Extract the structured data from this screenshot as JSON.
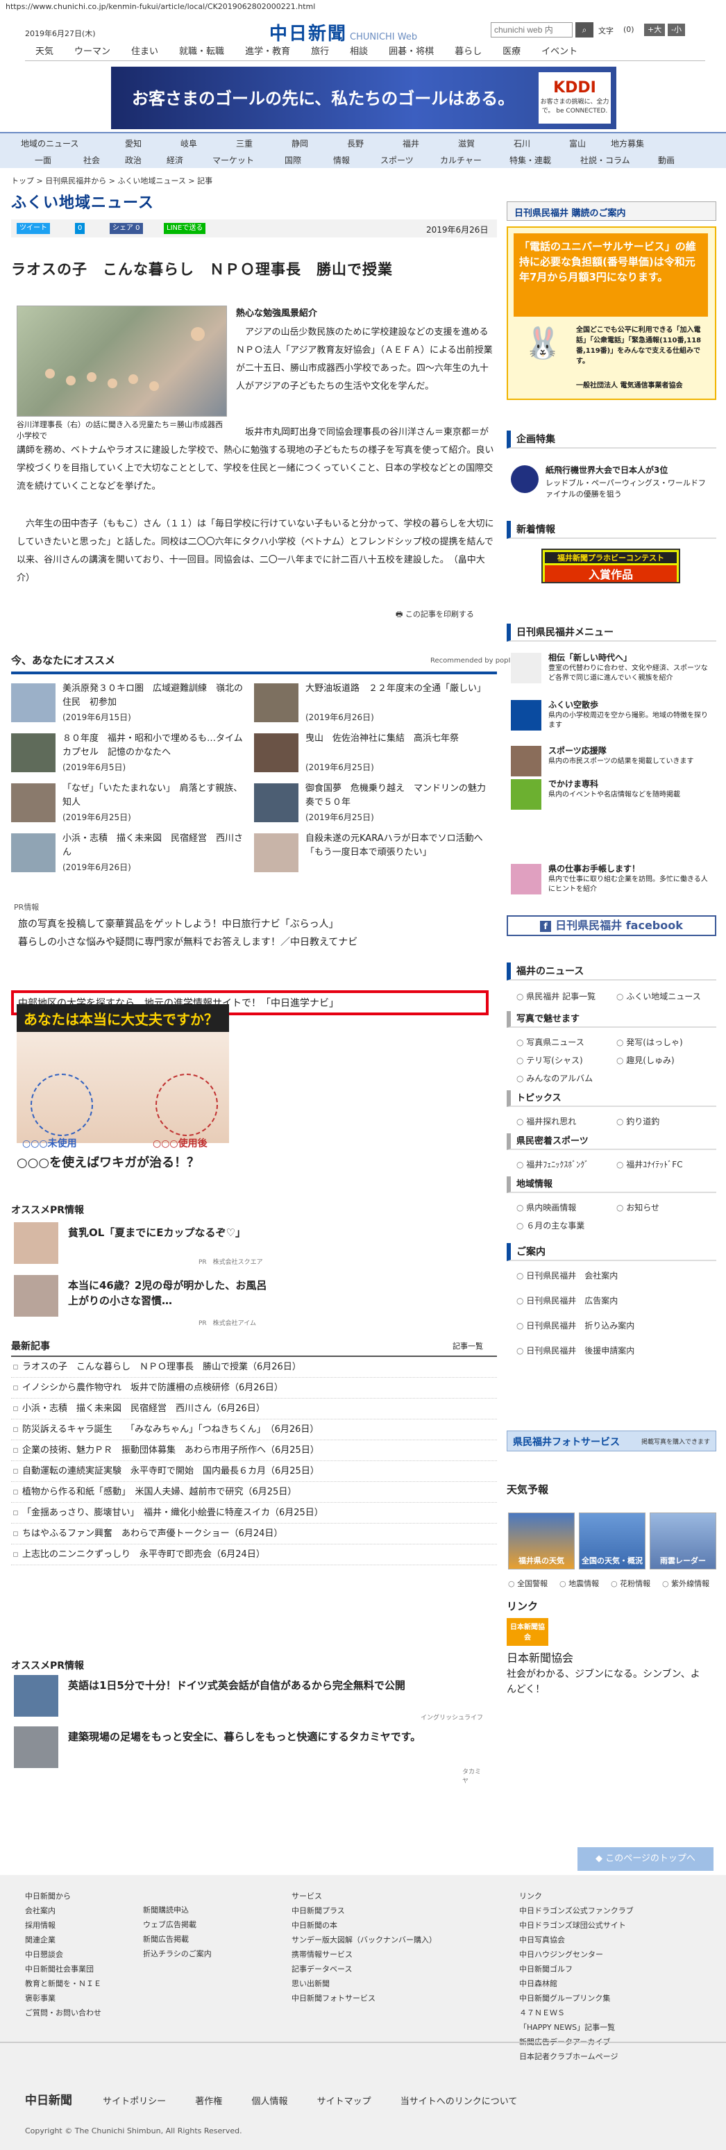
{
  "url": "https://www.chunichi.co.jp/kenmin-fukui/article/local/CK2019062802000221.html",
  "header": {
    "date": "2019年6月27日(木)",
    "logo": "中日新聞",
    "logo_sub": "CHUNICHI Web",
    "search_placeholder": "chunichi web 内",
    "search_icon": "search-icon",
    "font_label": "文字",
    "font_size": "(0)",
    "font_big": "+大",
    "font_small": "-小"
  },
  "gnav": [
    "天気",
    "ウーマン",
    "住まい",
    "就職・転職",
    "進学・教育",
    "旅行",
    "相談",
    "囲碁・将棋",
    "暮らし",
    "医療",
    "イベント"
  ],
  "banner": {
    "text": "お客さまのゴールの先に、私たちのゴールはある。",
    "brand": "KDDI",
    "brand_sub": "お客さまの挑戦に、全力で。 be CONNECTED."
  },
  "subnav_row1": [
    "地域のニュース",
    "愛知",
    "岐阜",
    "三重",
    "静岡",
    "長野",
    "福井",
    "滋賀",
    "石川",
    "富山",
    "地方募集"
  ],
  "subnav_row2": [
    "一面",
    "社会",
    "政治",
    "経済",
    "マーケット",
    "国際",
    "情報",
    "スポーツ",
    "カルチャー",
    "特集・連載",
    "社説・コラム",
    "動画"
  ],
  "breadcrumb": "トップ > 日刊県民福井から > ふくい地域ニュース > 記事",
  "section_title": "ふくい地域ニュース",
  "share": {
    "tweet": "ツイート",
    "hatena": "0",
    "fb": "シェア 0",
    "line": "LINEで送る"
  },
  "pub_date": "2019年6月26日",
  "article": {
    "title": "ラオスの子　こんな暮らし　ＮＰＯ理事長　勝山で授業",
    "photo_caption": "谷川洋理事長（右）の話に聞き入る児童たち＝勝山市成器西小学校で",
    "lead": "熱心な勉強風景紹介",
    "p1": "　アジアの山岳少数民族のために学校建設などの支援を進めるＮＰＯ法人「アジア教育友好協会」（ＡＥＦＡ）による出前授業が二十五日、勝山市成器西小学校であった。四～六年生の九十人がアジアの子どもたちの生活や文化を学んだ。",
    "p2": "　坂井市丸岡町出身で同協会理事長の谷川洋さん＝東京都＝が講師を務め、ベトナムやラオスに建設した学校で、熱心に勉強する現地の子どもたちの様子を写真を使って紹介。良い学校づくりを目指していく上で大切なこととして、学校を住民と一緒につくっていくこと、日本の学校などとの国際交流を続けていくことなどを挙げた。",
    "p3": "　六年生の田中杏子（ももこ）さん（１１）は「毎日学校に行けていない子もいると分かって、学校の暮らしを大切にしていきたいと思った」と話した。同校は二〇〇六年にタクハ小学校（ベトナム）とフレンドシップ校の提携を結んで以来、谷川さんの講演を開いており、十一回目。同協会は、二〇一八年までに計二百八十五校を建設した。　（畠中大介）",
    "print": "この記事を印刷する"
  },
  "recommend": {
    "title": "今、あなたにオススメ",
    "powered": "Recommended by popIn",
    "items": [
      {
        "t": "美浜原発３０キロ圏　広域避難訓練　嶺北の住民　初参加",
        "d": "(2019年6月15日)"
      },
      {
        "t": "大野油坂道路　２２年度末の全通「厳しい」",
        "d": "(2019年6月26日)"
      },
      {
        "t": "８０年度　福井・昭和小で埋めるも…タイムカプセル　記憶のかなたへ",
        "d": "(2019年6月5日)"
      },
      {
        "t": "曳山　佐佐治神社に集結　高浜七年祭",
        "d": "(2019年6月25日)"
      },
      {
        "t": "「なぜ」「いたたまれない」　肩落とす親族、知人",
        "d": "(2019年6月25日)"
      },
      {
        "t": "御食国夢　危機乗り越え　マンドリンの魅力奏で５０年",
        "d": "(2019年6月25日)"
      },
      {
        "t": "小浜・志積　描く未来図　民宿経営　西川さん",
        "d": "(2019年6月26日)"
      },
      {
        "t": "自殺未遂の元KARAハラが日本でソロ活動へ「もう一度日本で頑張りたい」",
        "d": ""
      }
    ]
  },
  "pr": {
    "label": "PR情報",
    "items": [
      "旅の写真を投稿して豪華賞品をゲットしよう！中日旅行ナビ「ぶらっ人」",
      "暮らしの小さな悩みや疑問に専門家が無料でお答えします！／中日教えてナビ",
      "中部地区の大学を探すなら、地元の進学情報サイトで！「中日進学ナビ」"
    ]
  },
  "ad2": {
    "top": "あなたは本当に大丈夫ですか？",
    "before": "○○○未使用",
    "after": "○○○使用後",
    "caption": "○○○を使えばワキガが治る！？"
  },
  "pr2": {
    "title": "オススメPR情報",
    "items": [
      {
        "t": "貧乳OL「夏までにEカップなるぞ♡」",
        "s": "PR　株式会社スクエア"
      },
      {
        "t": "本当に46歳？2児の母が明かした、お風呂上がりの小さな習慣…",
        "s": "PR　株式会社アイム"
      }
    ]
  },
  "latest": {
    "title": "最新記事",
    "more": "記事一覧",
    "items": [
      "ラオスの子　こんな暮らし　ＮＰＯ理事長　勝山で授業（6月26日）",
      "イノシシから農作物守れ　坂井で防護柵の点検研修（6月26日）",
      "小浜・志積　描く未来図　民宿経営　西川さん（6月26日）",
      "防災訴えるキャラ誕生　　「みなみちゃん」「つねきちくん」　（6月26日）",
      "企業の技術、魅力ＰＲ　振動団体募集　あわら市用子所作へ（6月25日）",
      "自動運転の連続実証実験　永平寺町で開始　国内最長６カ月（6月25日）",
      "植物から作る和紙「感動」　米国人夫婦、越前市で研究（6月25日）",
      "「金揺あっさり、膨壊甘い」　福井・織化小絵畳に特産スイカ（6月25日）",
      "ちはやふるファン興奮　あわらで声優トークショー（6月24日）",
      "上志比のニンニクずっしり　永平寺町で即売会（6月24日）"
    ]
  },
  "pr3": {
    "title": "オススメPR情報",
    "items": [
      {
        "t": "英語は1日5分で十分！ドイツ式英会話が自信があるから完全無料で公開",
        "s": "イングリッシュライフ"
      },
      {
        "t": "建築現場の足場をもっと安全に、暮らしをもっと快適にするタカミヤです。",
        "s": "タカミヤ"
      }
    ]
  },
  "right": {
    "subscribe_head": "日刊県民福井 購読のご案内",
    "subscribe_ad": "「電話のユニバーサルサービス」の維持に必要な負担額(番号単価)は令和元年7月から月額3円になります。",
    "subscribe_ad_sub": "全国どこでも公平に利用できる「加入電話」「公衆電話」「緊急通報(110番,118番,119番)」をみんなで支える仕組みです。",
    "subscribe_ad_org": "一般社団法人 電気通信事業者協会",
    "kikaku_head": "企画特集",
    "kikaku_item": "紙飛行機世界大会で日本人が3位",
    "kikaku_sub": "レッドブル・ペーパーウィングス・ワールドファイナルの優勝を狙う",
    "arrivals_head": "新着情報",
    "contest_line1": "福井新聞プラホビーコンテスト",
    "contest_line2": "入賞作品",
    "menu_head": "日刊県民福井メニュー",
    "menu": [
      {
        "t": "相伝「新しい時代へ」",
        "s": "豊室の代替わりに合わせ、文化や経済、スポーツなど各界で同じ道に進んでいく親族を紹介"
      },
      {
        "t": "ふくい空散歩",
        "s": "県内の小学校周辺を空から撮影。地域の特徴を探ります"
      },
      {
        "t": "スポーツ応援隊",
        "s": "県内の市民スポーツの結果を掲載していきます"
      },
      {
        "t": "でかけま専科",
        "s": "県内のイベントや名店情報などを随時掲載"
      },
      {
        "t": "県の仕事お手帳します！",
        "s": "県内で仕事に取り組む企業を訪問。多忙に働きる人にヒントを紹介"
      }
    ],
    "facebook": "日刊県民福井 facebook",
    "fukui_head": "福井のニュース",
    "fn1": [
      "県民福井 記事一覧",
      "ふくい地域ニュース"
    ],
    "photo_head": "写真で魅せます",
    "fn2": [
      "写真県ニュース",
      "発写(はっしゃ)",
      "テリ写(シャス)",
      "趣見(しゅみ)",
      "みんなのアルバム"
    ],
    "topics_head": "トピックス",
    "fn3": [
      "福井探れ思れ",
      "釣り道釣"
    ],
    "sports_head": "県民密着スポーツ",
    "fn4": [
      "福井ﾌｪﾆｯｸｽﾎﾞﾝｸﾞ",
      "福井ﾕﾅｲﾃｯﾄﾞFC"
    ],
    "region_head": "地域情報",
    "fn5": [
      "県内映画情報",
      "お知らせ",
      "６月の主な事業"
    ],
    "guide_head": "ご案内",
    "guide": [
      "日刊県民福井　会社案内",
      "日刊県民福井　広告案内",
      "日刊県民福井　折り込み案内",
      "日刊県民福井　後援申請案内"
    ],
    "photo_service": "県民福井フォトサービス",
    "photo_service_sub": "掲載写真を購入できます",
    "weather_head": "天気予報",
    "weather": [
      "福井県の天気",
      "全国の天気・概況",
      "雨雲レーダー"
    ],
    "warn": [
      "全国警報",
      "地震情報",
      "花粉情報",
      "紫外線情報"
    ],
    "link_head": "リンク",
    "link_logo": "日本新聞協会",
    "link_title": "日本新聞協会",
    "link_sub": "社会がわかる、ジブンになる。シンブン、よんどく！"
  },
  "totop": "このページのトップへ",
  "footer": {
    "c1_head": "中日新聞から",
    "c1": [
      "会社案内",
      "採用情報",
      "関連企業",
      "中日懇談会",
      "中日新聞社会事業団",
      "教育と新聞を・ＮＩＥ",
      "褒彰事業",
      "ご質問・お問い合わせ"
    ],
    "c2": [
      "新聞購読申込",
      "ウェブ広告掲載",
      "新聞広告掲載",
      "折込チラシのご案内"
    ],
    "c3_head": "サービス",
    "c3": [
      "中日新聞プラス",
      "中日新聞の本",
      "サンデー版大図解（バックナンバー購入）",
      "携帯情報サービス",
      "記事データベース",
      "思い出新聞",
      "中日新聞フォトサービス"
    ],
    "c4_head": "リンク",
    "c4": [
      "中日ドラゴンズ公式ファンクラブ",
      "中日ドラゴンズ球団公式サイト",
      "中日写真協会",
      "中日ハウジングセンター",
      "中日新聞ゴルフ",
      "中日森林館",
      "中日新聞グループリンク集",
      "４７ＮＥＷＳ",
      "「HAPPY NEWS」記事一覧",
      "新聞広告データアーカイブ",
      "日本記者クラブホームページ"
    ],
    "bar_logo": "中日新聞",
    "bar": [
      "サイトポリシー",
      "著作権",
      "個人情報",
      "サイトマップ",
      "当サイトへのリンクについて"
    ],
    "copy": "Copyright © The Chunichi Shimbun, All Rights Reserved."
  }
}
